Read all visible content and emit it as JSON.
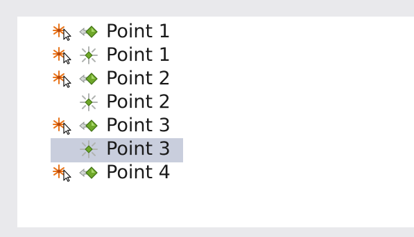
{
  "tree": {
    "items": [
      {
        "label": "Point 1",
        "icon_a": "orange-snap-cursor-icon",
        "icon_b": "green-diamond-arrow-icon",
        "selected": false
      },
      {
        "label": "Point 1",
        "icon_a": "orange-snap-cursor-icon",
        "icon_b": "green-point-sparkle-icon",
        "selected": false
      },
      {
        "label": "Point 2",
        "icon_a": "orange-snap-cursor-icon",
        "icon_b": "green-diamond-arrow-icon",
        "selected": false
      },
      {
        "label": "Point 2",
        "icon_a": "",
        "icon_b": "green-point-sparkle-icon",
        "selected": false
      },
      {
        "label": "Point 3",
        "icon_a": "orange-snap-cursor-icon",
        "icon_b": "green-diamond-arrow-icon",
        "selected": false
      },
      {
        "label": "Point 3",
        "icon_a": "",
        "icon_b": "green-point-sparkle-icon",
        "selected": true
      },
      {
        "label": "Point 4",
        "icon_a": "orange-snap-cursor-icon",
        "icon_b": "green-diamond-arrow-icon",
        "selected": false
      }
    ]
  },
  "colors": {
    "background": "#e9e9ec",
    "panel": "#ffffff",
    "selection": "#c9cedd",
    "accent_orange": "#e8741a",
    "accent_green": "#6fa82a"
  }
}
